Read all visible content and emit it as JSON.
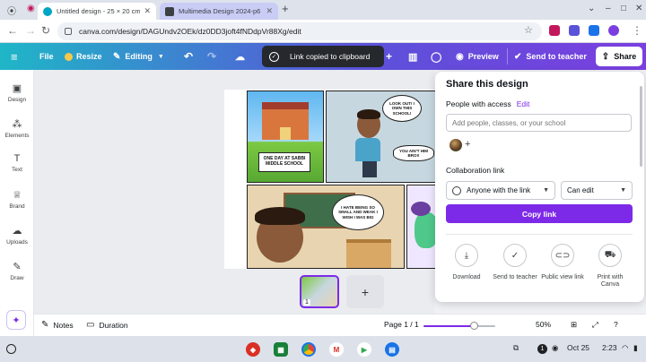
{
  "browser": {
    "tabs": [
      {
        "title": "Untitled design - 25 × 20 cm - C",
        "active": true
      },
      {
        "title": "Multimedia Design 2024-p6 6",
        "active": false
      }
    ],
    "url": "canva.com/design/DAGUndv2OEk/dz0DD3joft4fNDdpVr88Xg/edit",
    "icons": [
      "back-icon",
      "forward-icon",
      "reload-icon",
      "star-icon",
      "extension-icon",
      "menu-icon"
    ]
  },
  "canva_header": {
    "file_label": "File",
    "resize_label": "Resize",
    "editing_label": "Editing",
    "preview_label": "Preview",
    "send_to_teacher_label": "Send to teacher",
    "share_label": "Share",
    "gradient": [
      "#1fb6c7",
      "#5a52d9",
      "#7b3fe0"
    ]
  },
  "toast": {
    "text": "Link copied to clipboard"
  },
  "sidebar": {
    "items": [
      {
        "label": "Design",
        "icon": "design-icon"
      },
      {
        "label": "Elements",
        "icon": "elements-icon"
      },
      {
        "label": "Text",
        "icon": "text-icon"
      },
      {
        "label": "Brand",
        "icon": "brand-icon"
      },
      {
        "label": "Uploads",
        "icon": "uploads-icon"
      },
      {
        "label": "Draw",
        "icon": "draw-icon"
      }
    ]
  },
  "comic": {
    "caption_1": "ONE DAY AT SABBI MIDDLE SCHOOL",
    "bubble_1": "LOOK OUT! I OWN THIS SCHOOL!",
    "bubble_2": "YOU AIN'T HIM BRO!!",
    "bubble_3": "I HATE BEING SO SMALL AND WEAK I WISH I WAS BIG"
  },
  "pages": {
    "thumb_number": "1"
  },
  "footer": {
    "notes_label": "Notes",
    "duration_label": "Duration",
    "page_indicator": "Page 1 / 1",
    "zoom_value": 50,
    "zoom": "50%"
  },
  "share_panel": {
    "title": "Share this design",
    "people_label": "People with access",
    "edit_label": "Edit",
    "input_placeholder": "Add people, classes, or your school",
    "collab_label": "Collaboration link",
    "access_option": "Anyone with the link",
    "permission_option": "Can edit",
    "copy_button": "Copy link",
    "actions": [
      {
        "label": "Download",
        "icon": "download-icon"
      },
      {
        "label": "Send to teacher",
        "icon": "send-check-icon"
      },
      {
        "label": "Public view link",
        "icon": "link-icon"
      },
      {
        "label": "Print with Canva",
        "icon": "truck-icon"
      }
    ],
    "accent": "#7d2ae8"
  },
  "shelf": {
    "date": "Oct 25",
    "time": "2:23",
    "notification_count": "1"
  }
}
